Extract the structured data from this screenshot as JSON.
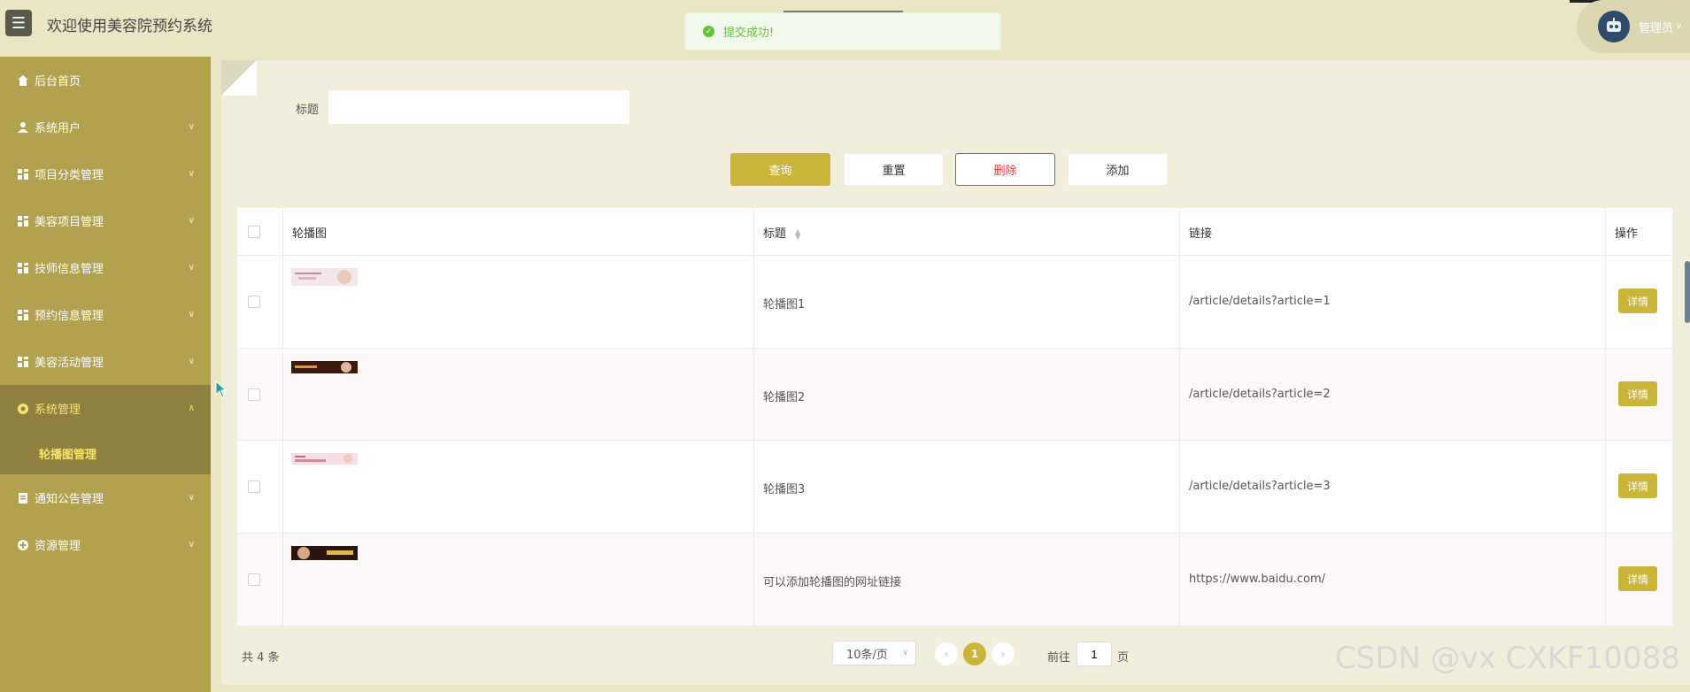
{
  "header": {
    "title": "欢迎使用美容院预约系统",
    "menu_icon": "hamburger-icon",
    "admin_name": "管理员"
  },
  "toast": {
    "message": "提交成功!"
  },
  "sidebar": {
    "items": [
      {
        "label": "后台首页",
        "icon": "home-icon",
        "expandable": false
      },
      {
        "label": "系统用户",
        "icon": "user-icon",
        "expandable": true
      },
      {
        "label": "项目分类管理",
        "icon": "grid-icon",
        "expandable": true
      },
      {
        "label": "美容项目管理",
        "icon": "grid-icon",
        "expandable": true
      },
      {
        "label": "技师信息管理",
        "icon": "grid-icon",
        "expandable": true
      },
      {
        "label": "预约信息管理",
        "icon": "grid-icon",
        "expandable": true
      },
      {
        "label": "美容活动管理",
        "icon": "grid-icon",
        "expandable": true
      },
      {
        "label": "系统管理",
        "icon": "gear-icon",
        "expandable": true,
        "active": true
      },
      {
        "label": "通知公告管理",
        "icon": "doc-icon",
        "expandable": true
      },
      {
        "label": "资源管理",
        "icon": "plus-circle-icon",
        "expandable": true
      }
    ],
    "sub_item": "轮播图管理"
  },
  "search": {
    "label": "标题",
    "value": "",
    "placeholder": ""
  },
  "buttons": {
    "query": "查询",
    "reset": "重置",
    "delete": "删除",
    "add": "添加"
  },
  "table": {
    "headers": [
      "轮播图",
      "标题",
      "链接",
      "操作"
    ],
    "rows": [
      {
        "title": "轮播图1",
        "link": "/article/details?article=1",
        "action": "详情"
      },
      {
        "title": "轮播图2",
        "link": "/article/details?article=2",
        "action": "详情"
      },
      {
        "title": "轮播图3",
        "link": "/article/details?article=3",
        "action": "详情"
      },
      {
        "title": "可以添加轮播图的网址链接",
        "link": "https://www.baidu.com/",
        "action": "详情"
      }
    ]
  },
  "pagination": {
    "total": "共 4 条",
    "page_size": "10条/页",
    "current": "1",
    "goto_label": "前往",
    "goto_value": "1",
    "suffix": "页"
  },
  "watermark": "CSDN @vx  CXKF10088",
  "colors": {
    "accent": "#cbb43a",
    "sidebar": "#b2a14f",
    "sidebar_active": "#8e8040",
    "highlight": "#fbe36b",
    "danger": "#e13b3b"
  }
}
